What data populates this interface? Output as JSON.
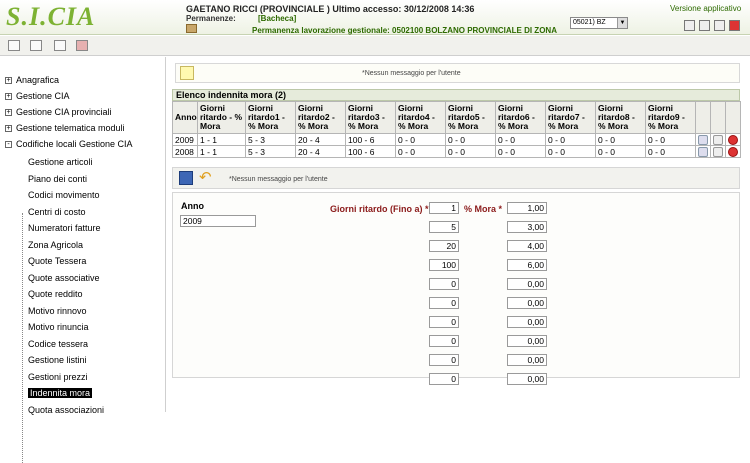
{
  "header": {
    "logo": "S.I.CIA",
    "user": "GAETANO RICCI (PROVINCIALE ) Ultimo accesso: 30/12/2008 14:36",
    "permanenze_label": "Permanenze:",
    "permanenze_value": "[Bacheca]",
    "lavorazione": "Permanenza lavorazione gestionale: 0502100 BOLZANO PROVINCIALE DI ZONA",
    "select_value": "05021) BZ",
    "version": "Versione applicativo"
  },
  "sidebar": {
    "items": [
      {
        "label": "Anagrafica",
        "pm": "+"
      },
      {
        "label": "Gestione CIA",
        "pm": "+"
      },
      {
        "label": "Gestione CIA provinciali",
        "pm": "+"
      },
      {
        "label": "Gestione telematica moduli",
        "pm": "+"
      },
      {
        "label": "Codifiche locali Gestione CIA",
        "pm": "-"
      }
    ],
    "sub": [
      "Gestione articoli",
      "Piano dei conti",
      "Codici movimento",
      "Centri di costo",
      "Numeratori fatture",
      "Zona Agricola",
      "Quote Tessera",
      "Quote associative",
      "Quote reddito",
      "Motivo rinnovo",
      "Motivo rinuncia",
      "Codice tessera",
      "Gestione listini",
      "Gestioni prezzi",
      "Indennita mora",
      "Quota associazioni"
    ],
    "selected": "Indennita mora"
  },
  "main": {
    "message": "*Nessun messaggio per l'utente",
    "grid_title": "Elenco indennita mora (2)",
    "columns": [
      "Anno",
      "Giorni ritardo - % Mora",
      "Giorni ritardo1 - % Mora",
      "Giorni ritardo2 - % Mora",
      "Giorni ritardo3 - % Mora",
      "Giorni ritardo4 - % Mora",
      "Giorni ritardo5 - % Mora",
      "Giorni ritardo6 - % Mora",
      "Giorni ritardo7 - % Mora",
      "Giorni ritardo8 - % Mora",
      "Giorni ritardo9 - % Mora"
    ],
    "rows": [
      [
        "2009",
        "1 - 1",
        "5 - 3",
        "20 - 4",
        "100 - 6",
        "0 - 0",
        "0 - 0",
        "0 - 0",
        "0 - 0",
        "0 - 0",
        "0 - 0"
      ],
      [
        "2008",
        "1 - 1",
        "5 - 3",
        "20 - 4",
        "100 - 6",
        "0 - 0",
        "0 - 0",
        "0 - 0",
        "0 - 0",
        "0 - 0",
        "0 - 0"
      ]
    ],
    "form_message": "*Nessun messaggio per l'utente",
    "form": {
      "anno_label": "Anno",
      "anno_value": "2009",
      "giorni_label": "Giorni ritardo (Fino a) *",
      "mora_label": "% Mora *",
      "giorni": [
        "1",
        "5",
        "20",
        "100",
        "0",
        "0",
        "0",
        "0",
        "0",
        "0"
      ],
      "mora": [
        "1,00",
        "3,00",
        "4,00",
        "6,00",
        "0,00",
        "0,00",
        "0,00",
        "0,00",
        "0,00",
        "0,00"
      ]
    }
  }
}
